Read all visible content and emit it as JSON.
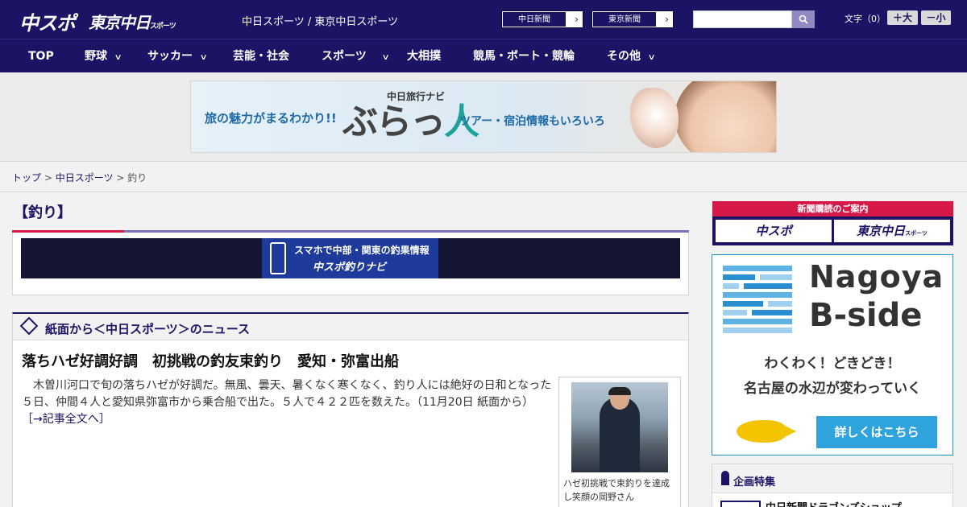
{
  "header": {
    "logo_chunichi": "中スポ",
    "logo_tokyo": "東京中日",
    "logo_tokyo_small": "スポーツ",
    "site_title": "中日スポーツ / 東京中日スポーツ",
    "paper_buttons": [
      {
        "label": "中日新聞",
        "arrow": "›"
      },
      {
        "label": "東京新聞",
        "arrow": "›"
      }
    ],
    "search": {
      "placeholder": "",
      "value": ""
    },
    "font_size_label": "文字（0）",
    "font_larger": "＋大",
    "font_smaller": "－小"
  },
  "nav": {
    "items": [
      {
        "label": "TOP",
        "has_menu": false
      },
      {
        "label": "野球",
        "has_menu": true
      },
      {
        "label": "サッカー",
        "has_menu": true
      },
      {
        "label": "芸能・社会",
        "has_menu": false
      },
      {
        "label": "スポーツ",
        "has_menu": true
      },
      {
        "label": "大相撲",
        "has_menu": false
      },
      {
        "label": "競馬・ボート・競輪",
        "has_menu": false
      },
      {
        "label": "その他",
        "has_menu": true
      }
    ],
    "chevron": "∨"
  },
  "ad_banner": {
    "left_text": "旅の魅力がまるわかり!!",
    "sub_title": "中日旅行ナビ",
    "logo_a": "ぶらっ",
    "logo_b": "人",
    "right_text": "ツアー・宿泊情報もいろいろ"
  },
  "breadcrumb": {
    "home": "トップ",
    "sep": " > ",
    "section": "中日スポーツ",
    "current": "釣り"
  },
  "page_title": "【釣り】",
  "tsuri_navi": {
    "line1": "スマホで中部・関東の釣果情報",
    "line2": "中スポ釣りナビ"
  },
  "news": {
    "section_title": "紙面から＜中日スポーツ＞のニュース",
    "headline": "落ちハゼ好調好調　初挑戦の釣友束釣り　愛知・弥富出船",
    "lead": "木曽川河口で旬の落ちハゼが好調だ。無風、曇天、暑くなく寒くなく、釣り人には絶好の日和となった５日、仲間４人と愛知県弥富市から乗合船で出た。５人で４２２匹を数えた。（11月20日 紙面から）",
    "more_link": "［→記事全文へ］",
    "photo_caption": "ハゼ初挑戦で束釣りを達成し笑顔の岡野さん"
  },
  "sidebar": {
    "subscribe_head": "新聞購読のご案内",
    "subscribe_chunichi": "中スポ",
    "subscribe_tokyo": "東京中日",
    "subscribe_tokyo_small": "スポーツ",
    "bside_title1": "Nagoya",
    "bside_title2": "B-side",
    "bside_line1": "わくわく！どきどき！",
    "bside_line2": "名古屋の水辺が変わっていく",
    "bside_button": "詳しくはこちら",
    "kikaku_title": "企画特集",
    "kikaku_item": "中日新聞ドラゴンズショップ"
  },
  "colors": {
    "brand_navy": "#1b1464",
    "accent_red": "#d7194a",
    "bside_blue": "#2ea3dc"
  }
}
